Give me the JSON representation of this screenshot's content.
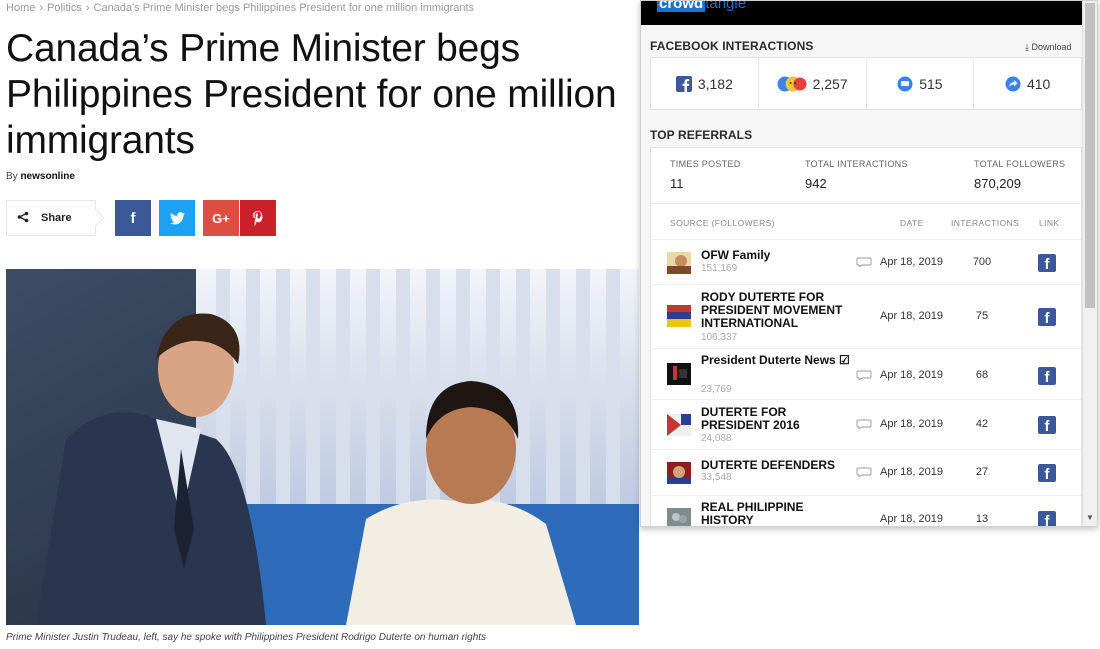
{
  "breadcrumb": {
    "home": "Home",
    "section": "Politics",
    "current": "Canada's Prime Minister begs Philippines President for one million immigrants"
  },
  "article": {
    "title": "Canada’s Prime Minister begs Philippines President for one million immigrants",
    "by_prefix": "By",
    "author": "newsonline",
    "share_label": "Share",
    "caption": "Prime Minister Justin Trudeau, left, say he spoke with Philippines President Rodrigo Duterte on human rights"
  },
  "share_buttons": {
    "facebook": "f",
    "twitter": "🐦",
    "googleplus": "G+",
    "pinterest": "P"
  },
  "crowdtangle": {
    "logo_bold": "crowd",
    "logo_light": "tangle",
    "facebook_title": "FACEBOOK INTERACTIONS",
    "download_label": "Download",
    "interactions": [
      {
        "icon": "facebook-icon",
        "value": "3,182"
      },
      {
        "icon": "reactions-icon",
        "value": "2,257"
      },
      {
        "icon": "comment-icon",
        "value": "515"
      },
      {
        "icon": "share-icon",
        "value": "410"
      }
    ],
    "referrals_title": "TOP REFERRALS",
    "summary": {
      "times_posted_label": "TIMES POSTED",
      "times_posted": "11",
      "total_interactions_label": "TOTAL INTERACTIONS",
      "total_interactions": "942",
      "total_followers_label": "TOTAL FOLLOWERS",
      "total_followers": "870,209"
    },
    "columns": {
      "source": "SOURCE (FOLLOWERS)",
      "date": "DATE",
      "interactions": "INTERACTIONS",
      "link": "LINK"
    },
    "rows": [
      {
        "name": "OFW Family",
        "followers": "151,169",
        "date": "Apr 18, 2019",
        "interactions": "700"
      },
      {
        "name": "RODY DUTERTE FOR PRESIDENT MOVEMENT INTERNATIONAL",
        "followers": "106,337",
        "date": "Apr 18, 2019",
        "interactions": "75"
      },
      {
        "name": "President Duterte News ☑",
        "followers": "23,769",
        "date": "Apr 18, 2019",
        "interactions": "68"
      },
      {
        "name": "DUTERTE FOR PRESIDENT 2016",
        "followers": "24,088",
        "date": "Apr 18, 2019",
        "interactions": "42"
      },
      {
        "name": "DUTERTE DEFENDERS",
        "followers": "33,548",
        "date": "Apr 18, 2019",
        "interactions": "27"
      },
      {
        "name": "REAL PHILIPPINE HISTORY",
        "followers": "",
        "date": "Apr 18, 2019",
        "interactions": "13"
      }
    ],
    "link_glyph": "f"
  },
  "colors": {
    "facebook_blue": "#3b5998",
    "twitter_blue": "#1da1f2",
    "gplus_red": "#dc4e41",
    "pinterest_red": "#ca212a",
    "crowdtangle_blue": "#1a73c8"
  }
}
